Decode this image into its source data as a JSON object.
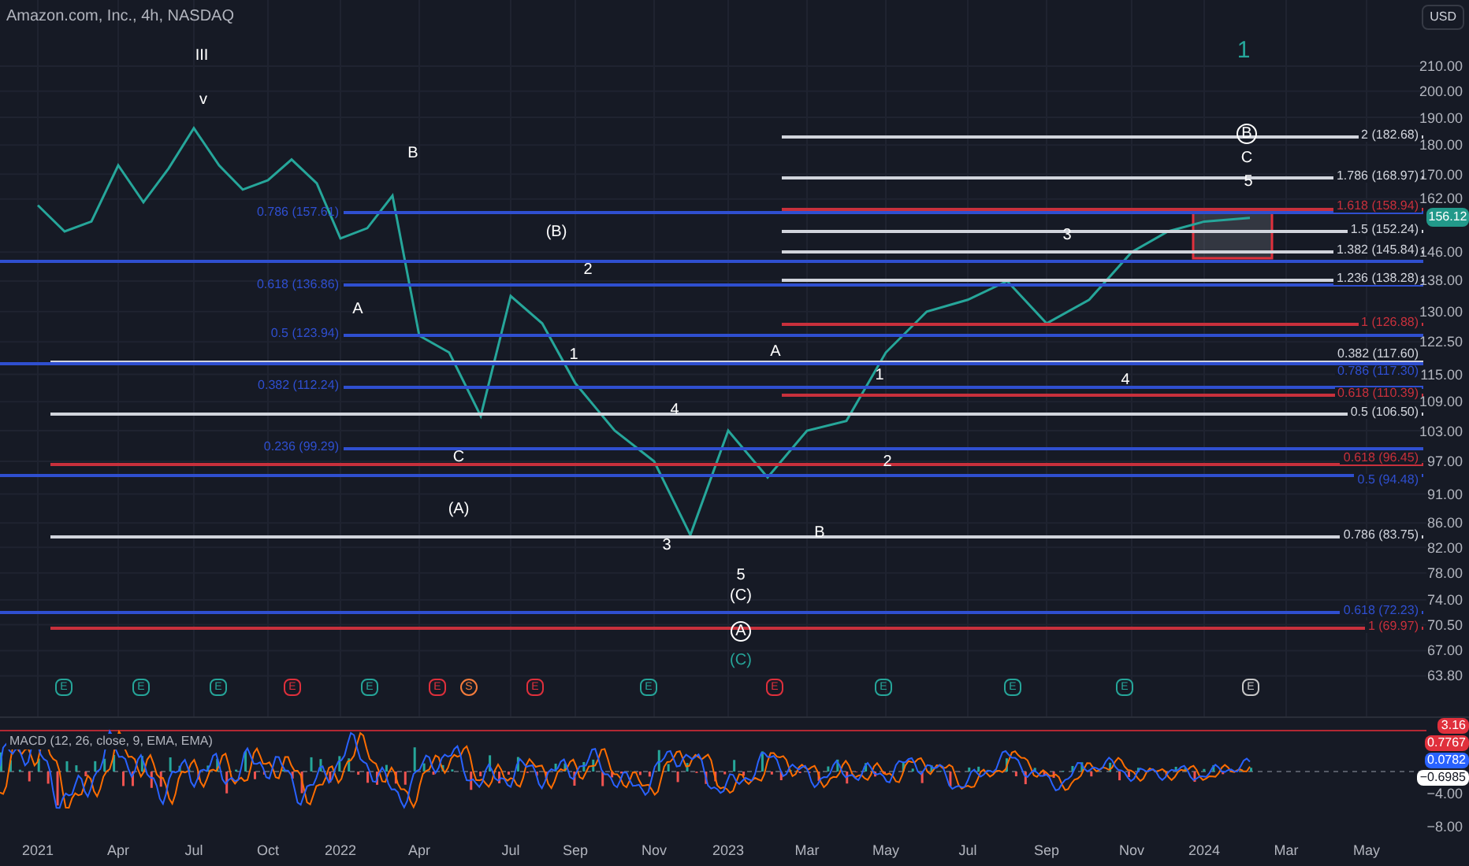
{
  "header": {
    "title": "Amazon.com, Inc., 4h, NASDAQ",
    "currency_button": "USD"
  },
  "price_chart": {
    "current_price": "156.12",
    "price_axis_labels": [
      "210.00",
      "200.00",
      "190.00",
      "180.00",
      "170.00",
      "162.00",
      "146.00",
      "138.00",
      "130.00",
      "122.50",
      "115.00",
      "109.00",
      "103.00",
      "97.00",
      "91.00",
      "86.00",
      "82.00",
      "78.00",
      "74.00",
      "70.50",
      "67.00",
      "63.80"
    ],
    "time_axis_labels": [
      "2021",
      "Apr",
      "Jul",
      "Oct",
      "2022",
      "Apr",
      "Jul",
      "Sep",
      "Nov",
      "2023",
      "Mar",
      "May",
      "Jul",
      "Sep",
      "Nov",
      "2024",
      "Mar",
      "May"
    ]
  },
  "fib_levels": [
    {
      "label": "2 (182.68)",
      "color": "#d1d4dc"
    },
    {
      "label": "1.786 (168.97)",
      "color": "#d1d4dc"
    },
    {
      "label": "0.786 (157.61)",
      "color": "#2f4fd0"
    },
    {
      "label": "1.618 (158.94)",
      "color": "#c8303c"
    },
    {
      "label": "1.5 (152.24)",
      "color": "#d1d4dc"
    },
    {
      "color": "#2f4fd0"
    },
    {
      "label": "1.382 (145.84)",
      "color": "#d1d4dc"
    },
    {
      "label": "0.618 (136.86)",
      "color": "#2f4fd0"
    },
    {
      "label": "1.236 (138.28)",
      "color": "#d1d4dc"
    },
    {
      "label": "1 (126.88)",
      "color": "#c8303c"
    },
    {
      "label": "0.5 (123.94)",
      "color": "#2f4fd0"
    },
    {
      "label": "0.382 (117.60)",
      "color": "#d1d4dc"
    },
    {
      "label": "0.786 (117.30)",
      "color": "#2f4fd0"
    },
    {
      "label": "0.382 (112.24)",
      "color": "#2f4fd0"
    },
    {
      "label": "0.618 (110.39)",
      "color": "#c8303c"
    },
    {
      "label": "0.5 (106.50)",
      "color": "#d1d4dc"
    },
    {
      "label": "0.236 (99.29)",
      "color": "#2f4fd0"
    },
    {
      "label": "0.618 (96.45)",
      "color": "#c8303c"
    },
    {
      "label": "0.5 (94.48)",
      "color": "#2f4fd0"
    },
    {
      "label": "0.786 (83.75)",
      "color": "#d1d4dc"
    },
    {
      "label": "0.618 (72.23)",
      "color": "#2f4fd0"
    },
    {
      "label": "1 (69.97)",
      "color": "#c8303c"
    }
  ],
  "wave_labels": [
    {
      "kind": "wave",
      "label": "III",
      "circled": false,
      "color": "#ffffff"
    },
    {
      "kind": "cycle",
      "label": "1",
      "circled": false,
      "color": "#26a69a"
    },
    {
      "kind": "wave",
      "label": "v",
      "circled": false,
      "color": "#ffffff"
    },
    {
      "kind": "wave",
      "label": "B",
      "circled": true,
      "color": "#ffffff"
    },
    {
      "kind": "wave",
      "label": "B",
      "circled": false,
      "color": "#ffffff"
    },
    {
      "kind": "wave",
      "label": "C",
      "circled": false,
      "color": "#ffffff"
    },
    {
      "kind": "wave",
      "label": "5",
      "circled": false,
      "color": "#ffffff"
    },
    {
      "kind": "wave",
      "label": "(B)",
      "circled": false,
      "color": "#ffffff"
    },
    {
      "kind": "wave",
      "label": "3",
      "circled": false,
      "color": "#ffffff"
    },
    {
      "kind": "wave",
      "label": "2",
      "circled": false,
      "color": "#ffffff"
    },
    {
      "kind": "wave",
      "label": "A",
      "circled": false,
      "color": "#ffffff"
    },
    {
      "kind": "wave",
      "label": "1",
      "circled": false,
      "color": "#ffffff"
    },
    {
      "kind": "wave",
      "label": "A",
      "circled": false,
      "color": "#ffffff"
    },
    {
      "kind": "wave",
      "label": "1",
      "circled": false,
      "color": "#ffffff"
    },
    {
      "kind": "wave",
      "label": "4",
      "circled": false,
      "color": "#ffffff"
    },
    {
      "kind": "wave",
      "label": "4",
      "circled": false,
      "color": "#ffffff"
    },
    {
      "kind": "wave",
      "label": "C",
      "circled": false,
      "color": "#ffffff"
    },
    {
      "kind": "wave",
      "label": "2",
      "circled": false,
      "color": "#ffffff"
    },
    {
      "kind": "wave",
      "label": "(A)",
      "circled": false,
      "color": "#ffffff"
    },
    {
      "kind": "wave",
      "label": "B",
      "circled": false,
      "color": "#ffffff"
    },
    {
      "kind": "wave",
      "label": "3",
      "circled": false,
      "color": "#ffffff"
    },
    {
      "kind": "wave",
      "label": "5",
      "circled": false,
      "color": "#ffffff"
    },
    {
      "kind": "wave",
      "label": "(C)",
      "circled": false,
      "color": "#ffffff"
    },
    {
      "kind": "wave",
      "label": "A",
      "circled": true,
      "color": "#ffffff"
    },
    {
      "kind": "wave",
      "label": "(C)",
      "circled": false,
      "color": "#26a69a"
    }
  ],
  "events": [
    {
      "kind": "earnings",
      "letter": "E",
      "color": "#26a69a"
    },
    {
      "kind": "earnings",
      "letter": "E",
      "color": "#26a69a"
    },
    {
      "kind": "earnings",
      "letter": "E",
      "color": "#26a69a"
    },
    {
      "kind": "earnings",
      "letter": "E",
      "color": "#e0303c"
    },
    {
      "kind": "earnings",
      "letter": "E",
      "color": "#26a69a"
    },
    {
      "kind": "earnings",
      "letter": "E",
      "color": "#e0303c"
    },
    {
      "kind": "split",
      "letter": "S",
      "color": "#f57c3c"
    },
    {
      "kind": "earnings",
      "letter": "E",
      "color": "#e0303c"
    },
    {
      "kind": "earnings",
      "letter": "E",
      "color": "#26a69a"
    },
    {
      "kind": "earnings",
      "letter": "E",
      "color": "#e0303c"
    },
    {
      "kind": "earnings",
      "letter": "E",
      "color": "#26a69a"
    },
    {
      "kind": "earnings",
      "letter": "E",
      "color": "#26a69a"
    },
    {
      "kind": "earnings",
      "letter": "E",
      "color": "#26a69a"
    },
    {
      "kind": "earnings",
      "letter": "E",
      "color": "#c9c9c9"
    }
  ],
  "macd": {
    "title": "MACD (12, 26, close, 9, EMA, EMA)",
    "value_badges": [
      {
        "text": "3.16",
        "color": "#e0303c"
      },
      {
        "text": "0.7767",
        "color": "#e0303c"
      },
      {
        "text": "0.0782",
        "color": "#2962ff"
      },
      {
        "text": "−0.6985",
        "color": "#ffffff"
      }
    ],
    "axis_labels": [
      "−4.00",
      "−8.00"
    ]
  }
}
